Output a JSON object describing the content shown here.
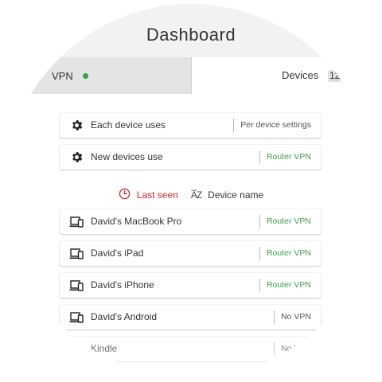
{
  "header": {
    "title": "Dashboard"
  },
  "tabs": {
    "vpn": {
      "label": "VPN",
      "status_color": "#3aa04a"
    },
    "devices": {
      "label": "Devices",
      "count": "12"
    }
  },
  "settings": [
    {
      "label": "Each device uses",
      "value": "Per device settings",
      "icon": "gear-icon"
    },
    {
      "label": "New devices use",
      "value": "Router VPN",
      "icon": "gear-icon"
    }
  ],
  "sort": {
    "last_seen": "Last seen",
    "device_name": "Device name"
  },
  "devices": [
    {
      "name": "David's MacBook Pro",
      "value": "Router VPN",
      "icon": "devices-icon"
    },
    {
      "name": "David's iPad",
      "value": "Router VPN",
      "icon": "devices-icon"
    },
    {
      "name": "David's iPhone",
      "value": "Router VPN",
      "icon": "devices-icon"
    },
    {
      "name": "David's Android",
      "value": "No VPN",
      "icon": "devices-icon"
    },
    {
      "name": "Kindle",
      "value": "No VPN",
      "icon": "devices-icon"
    }
  ],
  "colors": {
    "accent_green": "#3e9b4f",
    "accent_red": "#cc2a2a"
  }
}
